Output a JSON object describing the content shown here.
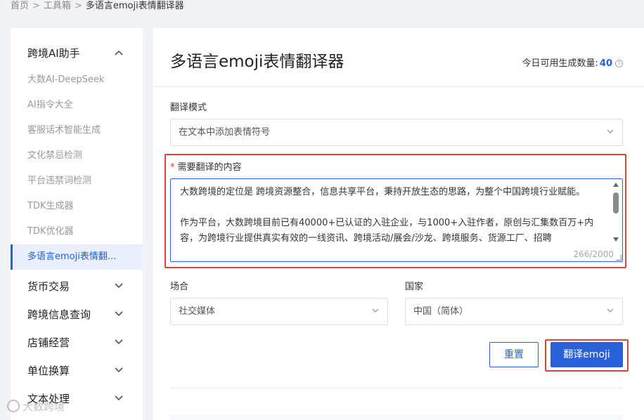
{
  "breadcrumb": {
    "home": "首页",
    "toolbox": "工具箱",
    "current": "多语言emoji表情翻译器",
    "separator": ">"
  },
  "sidebar": {
    "group_ai": {
      "label": "跨境AI助手",
      "items": [
        "大数AI-DeepSeek",
        "AI指令大全",
        "客服话术智能生成",
        "文化禁忌检测",
        "平台违禁词检测",
        "TDK生成器",
        "TDK优化器",
        "多语言emoji表情翻..."
      ]
    },
    "groups": [
      "货币交易",
      "跨境信息查询",
      "店铺经营",
      "单位换算",
      "文本处理"
    ]
  },
  "main": {
    "title": "多语言emoji表情翻译器",
    "quota_label": "今日可用生成数量:",
    "quota_value": "40",
    "quota_help": "?",
    "mode_label": "翻译模式",
    "mode_value": "在文本中添加表情符号",
    "content_required_mark": "*",
    "content_label": "需要翻译的内容",
    "content_value": "大数跨境的定位是 跨境资源整合，信息共享平台，秉持开放生态的思路，为整个中国跨境行业赋能。\n\n作为平台，大数跨境目前已有40000+已认证的入驻企业，与1000+入驻作者，原创与汇集数百万+内容，为跨境行业提供真实有效的一线资讯、跨境活动/展会/沙龙、跨境服务、货源工厂、招聘",
    "content_counter": "266/2000",
    "scene_label": "场合",
    "scene_value": "社交媒体",
    "country_label": "国家",
    "country_value": "中国（简体）",
    "reset_label": "重置",
    "translate_label": "翻译emoji"
  },
  "watermark": "大数跨境",
  "colors": {
    "accent": "#2a61d8",
    "highlight": "#d9453a",
    "active_bg": "#e9effc"
  }
}
